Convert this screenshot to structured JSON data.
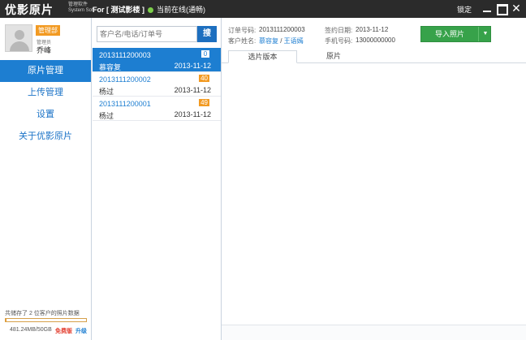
{
  "app": {
    "logo": "优影原片",
    "logo_sub_1": "管理软件",
    "logo_sub_2": "System Soft",
    "for_label": "For [ 测试影楼 ]",
    "online_status": "当前在线(通畅)",
    "lock_label": "锁定"
  },
  "user": {
    "role_badge": "管理部",
    "role_title": "管理员",
    "name": "乔峰"
  },
  "nav": {
    "items": [
      {
        "label": "原片管理",
        "active": true
      },
      {
        "label": "上传管理",
        "active": false
      },
      {
        "label": "设置",
        "active": false
      },
      {
        "label": "关于优影原片",
        "active": false
      }
    ]
  },
  "storage": {
    "summary": "共储存了 2 位客户的照片数据",
    "size": "481.24MB/50GB",
    "edition": "免费版",
    "upgrade": "升级",
    "used_fraction": 0.0094
  },
  "search": {
    "placeholder": "客户名/电话/订单号",
    "button_label": "搜"
  },
  "orders": [
    {
      "order_no": "2013111200003",
      "count": "0",
      "customer": "慕容复",
      "date": "2013-11-12",
      "selected": true
    },
    {
      "order_no": "2013111200002",
      "count": "40",
      "customer": "杨过",
      "date": "2013-11-12",
      "selected": false
    },
    {
      "order_no": "2013111200001",
      "count": "49",
      "customer": "杨过",
      "date": "2013-11-12",
      "selected": false
    }
  ],
  "detail": {
    "order_no_label": "订单号码:",
    "order_no_value": "2013111200003",
    "sign_date_label": "签约日期:",
    "sign_date_value": "2013-11-12",
    "customer_label": "客户姓名:",
    "customer_value_1": "慕容复",
    "customer_sep": " / ",
    "customer_value_2": "王语嫣",
    "phone_label": "手机号码:",
    "phone_value": "13000000000",
    "import_label": "导入照片",
    "tabs": [
      {
        "label": "选片版本",
        "active": true
      },
      {
        "label": "原片",
        "active": false
      }
    ]
  },
  "colors": {
    "titlebar": "#2b2b2b",
    "accent_blue": "#1d7ed1",
    "badge_orange": "#f29a22",
    "import_green": "#37a24a",
    "online_green": "#7ccf4a"
  }
}
